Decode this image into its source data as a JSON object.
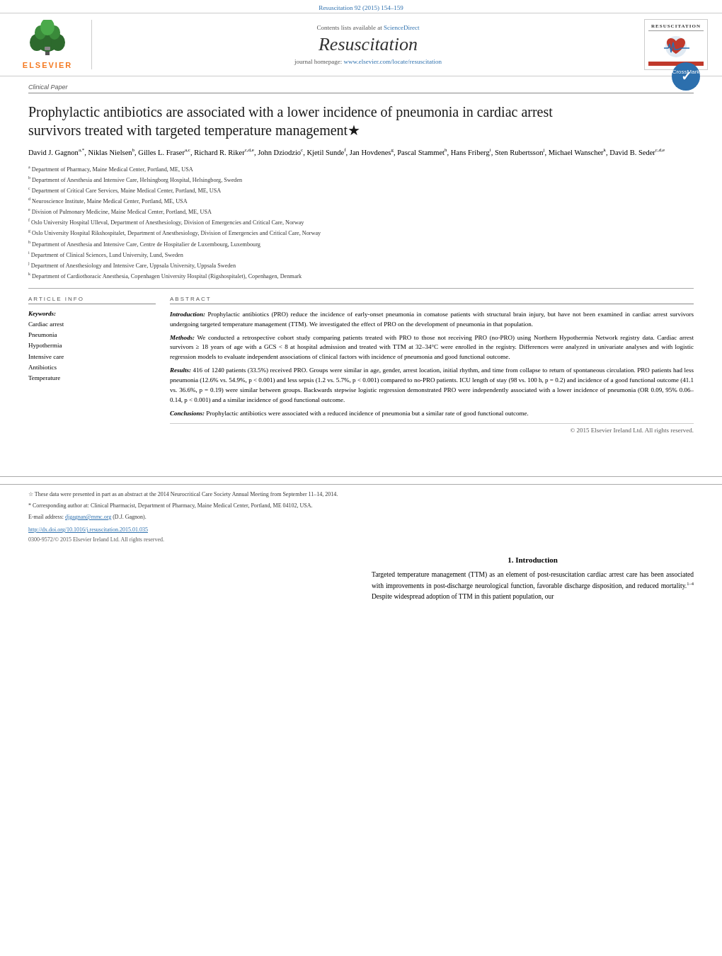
{
  "journal_header": {
    "top_citation": "Resuscitation 92 (2015) 154–159",
    "contents_prefix": "Contents lists available at",
    "sciencedirect_link": "ScienceDirect",
    "journal_title": "Resuscitation",
    "homepage_prefix": "journal homepage:",
    "homepage_url": "www.elsevier.com/locate/resuscitation",
    "elsevier_text": "ELSEVIER",
    "resuscitation_logo_title": "RESUSCITATION"
  },
  "article": {
    "section_label": "Clinical Paper",
    "title": "Prophylactic antibiotics are associated with a lower incidence of pneumonia in cardiac arrest survivors treated with targeted temperature management",
    "title_star": "★",
    "authors": "David J. Gagnon",
    "author_affiliations_inline": "a,*, Niklas Nielsen b, Gilles L. Fraser a,c, Richard R. Riker c,d,e, John Dziodzio c, Kjetil Sunde f, Jan Hovdenes g, Pascal Stammet h, Hans Friberg i, Sten Rubertsson j, Michael Wanscher k, David B. Seder c,d,e",
    "affiliations": [
      {
        "sup": "a",
        "text": "Department of Pharmacy, Maine Medical Center, Portland, ME, USA"
      },
      {
        "sup": "b",
        "text": "Department of Anesthesia and Intensive Care, Helsingborg Hospital, Helsingborg, Sweden"
      },
      {
        "sup": "c",
        "text": "Department of Critical Care Services, Maine Medical Center, Portland, ME, USA"
      },
      {
        "sup": "d",
        "text": "Neuroscience Institute, Maine Medical Center, Portland, ME, USA"
      },
      {
        "sup": "e",
        "text": "Division of Pulmonary Medicine, Maine Medical Center, Portland, ME, USA"
      },
      {
        "sup": "f",
        "text": "Oslo University Hospital Ulleval, Department of Anesthesiology, Division of Emergencies and Critical Care, Norway"
      },
      {
        "sup": "g",
        "text": "Oslo University Hospital Rikshospitalet, Department of Anesthesiology, Division of Emergencies and Critical Care, Norway"
      },
      {
        "sup": "h",
        "text": "Department of Anesthesia and Intensive Care, Centre de Hospitalier de Luxembourg, Luxembourg"
      },
      {
        "sup": "i",
        "text": "Department of Clinical Sciences, Lund University, Lund, Sweden"
      },
      {
        "sup": "j",
        "text": "Department of Anesthesiology and Intensive Care, Uppsala University, Uppsala Sweden"
      },
      {
        "sup": "k",
        "text": "Department of Cardiothoracic Anesthesia, Copenhagen University Hospital (Rigshospitalet), Copenhagen, Denmark"
      }
    ]
  },
  "article_info": {
    "header": "ARTICLE INFO",
    "keywords_label": "Keywords:",
    "keywords": [
      "Cardiac arrest",
      "Pneumonia",
      "Hypothermia",
      "Intensive care",
      "Antibiotics",
      "Temperature"
    ]
  },
  "abstract": {
    "header": "ABSTRACT",
    "introduction": {
      "label": "Introduction:",
      "text": "Prophylactic antibiotics (PRO) reduce the incidence of early-onset pneumonia in comatose patients with structural brain injury, but have not been examined in cardiac arrest survivors undergoing targeted temperature management (TTM). We investigated the effect of PRO on the development of pneumonia in that population."
    },
    "methods": {
      "label": "Methods:",
      "text": "We conducted a retrospective cohort study comparing patients treated with PRO to those not receiving PRO (no-PRO) using Northern Hypothermia Network registry data. Cardiac arrest survivors ≥ 18 years of age with a GCS < 8 at hospital admission and treated with TTM at 32–34°C were enrolled in the registry. Differences were analyzed in univariate analyses and with logistic regression models to evaluate independent associations of clinical factors with incidence of pneumonia and good functional outcome."
    },
    "results": {
      "label": "Results:",
      "text": "416 of 1240 patients (33.5%) received PRO. Groups were similar in age, gender, arrest location, initial rhythm, and time from collapse to return of spontaneous circulation. PRO patients had less pneumonia (12.6% vs. 54.9%, p < 0.001) and less sepsis (1.2 vs. 5.7%, p < 0.001) compared to no-PRO patients. ICU length of stay (98 vs. 100 h, p = 0.2) and incidence of a good functional outcome (41.1 vs. 36.6%, p = 0.19) were similar between groups. Backwards stepwise logistic regression demonstrated PRO were independently associated with a lower incidence of pneumonia (OR 0.09, 95% 0.06–0.14, p < 0.001) and a similar incidence of good functional outcome."
    },
    "conclusions": {
      "label": "Conclusions:",
      "text": "Prophylactic antibiotics were associated with a reduced incidence of pneumonia but a similar rate of good functional outcome."
    },
    "copyright": "© 2015 Elsevier Ireland Ltd. All rights reserved."
  },
  "footnotes": {
    "star_note": "These data were presented in part as an abstract at the 2014 Neurocritical Care Society Annual Meeting from September 11–14, 2014.",
    "corresponding_label": "* Corresponding author at:",
    "corresponding_text": "Clinical Pharmacist, Department of Pharmacy, Maine Medical Center, Portland, ME 04102, USA.",
    "email_label": "E-mail address:",
    "email": "djgagnan@mmc.org",
    "email_suffix": "(D.J. Gagnon).",
    "doi": "http://dx.doi.org/10.1016/j.resuscitation.2015.01.035",
    "issn": "0300-9572/© 2015 Elsevier Ireland Ltd. All rights reserved."
  },
  "introduction": {
    "section_number": "1.",
    "section_title": "Introduction",
    "text": "Targeted temperature management (TTM) as an element of post-resuscitation cardiac arrest care has been associated with improvements in post-discharge neurological function, favorable discharge disposition, and reduced mortality.",
    "superscript": "1–4",
    "text2": " Despite widespread adoption of TTM in this patient population, our"
  }
}
